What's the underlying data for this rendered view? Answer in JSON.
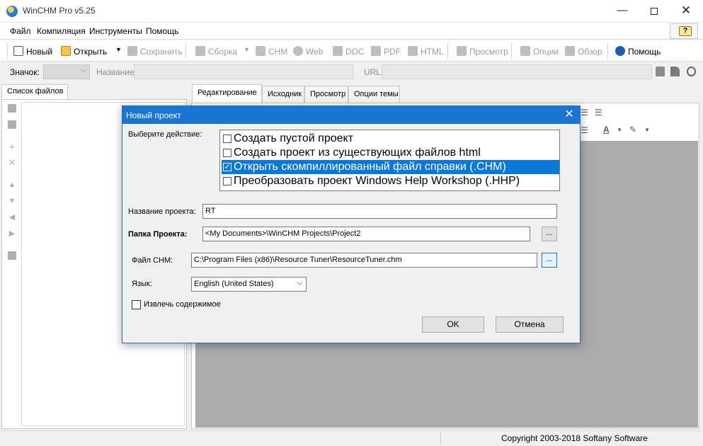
{
  "window": {
    "title": "WinCHM Pro v5.25",
    "minimize": "—",
    "close": "✕"
  },
  "menu": [
    "Файл",
    "Компиляция",
    "Инструменты",
    "Помощь"
  ],
  "toolbar": {
    "new": "Новый",
    "open": "Открыть",
    "save": "Сохранить",
    "build": "Сборка",
    "chm": "CHM",
    "web": "Web",
    "doc": "DOC",
    "pdf": "PDF",
    "html": "HTML",
    "preview": "Просмотр",
    "options": "Опции",
    "browse": "Обзор",
    "help": "Помощь"
  },
  "address_bar": {
    "icon_label": "Значок:",
    "name_label": "Название:",
    "url_label": "URL:"
  },
  "left_panel": {
    "tab": "Список файлов"
  },
  "editor": {
    "tabs": [
      "Редактирование",
      "Исходник",
      "Просмотр",
      "Опции темы"
    ],
    "active_tab": 0
  },
  "status": {
    "copyright": "Copyright 2003-2018 Softany Software"
  },
  "dialog": {
    "title": "Новый проект",
    "close": "✕",
    "action_label": "Выберите действие:",
    "actions": [
      {
        "label": "Создать пустой проект",
        "checked": false
      },
      {
        "label": "Создать проект из существующих файлов html",
        "checked": false
      },
      {
        "label": "Открыть скомпиллированный файл справки (.CHM)",
        "checked": true
      },
      {
        "label": "Преобразовать проект Windows Help Workshop (.HHP)",
        "checked": false
      }
    ],
    "selected_action": 2,
    "project_name_label": "Название проекта:",
    "project_name_value": "RT",
    "project_folder_label": "Папка Проекта:",
    "project_folder_value": "<My Documents>\\WinCHM Projects\\Project2",
    "chm_file_label": "Файл CHM:",
    "chm_file_value": "C:\\Program Files (x86)\\Resource Tuner\\ResourceTuner.chm",
    "browse": "...",
    "language_label": "Язык:",
    "language_value": "English (United States)",
    "extract_label": "Извлечь содержимое",
    "extract_checked": false,
    "ok": "OK",
    "cancel": "Отмена"
  },
  "colors": {
    "accent": "#1a74d2",
    "selection": "#0a78d7",
    "editor_bg": "#ababab"
  }
}
